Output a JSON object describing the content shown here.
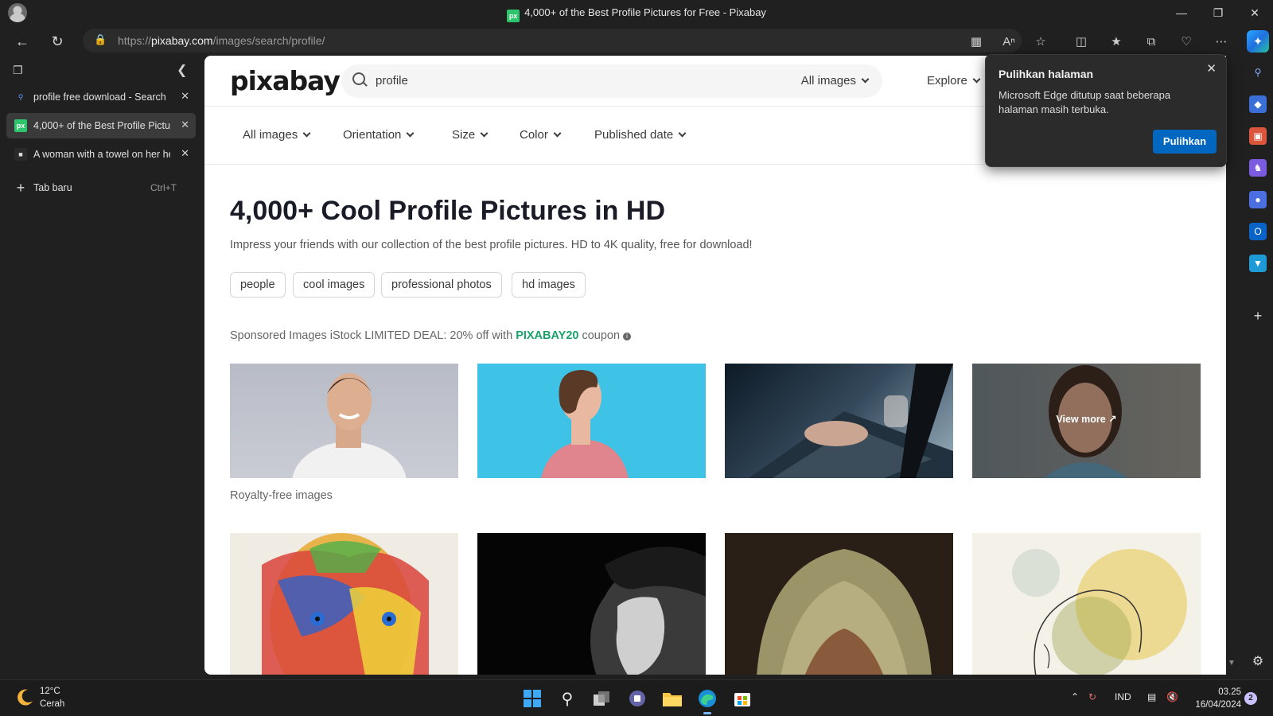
{
  "window": {
    "title": "4,000+ of the Best Profile Pictures for Free - Pixabay",
    "favicon_text": "px"
  },
  "address": {
    "url_prefix": "https://",
    "url_host": "pixabay.com",
    "url_path": "/images/search/profile/"
  },
  "tabs": [
    {
      "label": "profile free download - Search",
      "active": false
    },
    {
      "label": "4,000+ of the Best Profile Pictures for Free - Pixabay",
      "active": true
    },
    {
      "label": "A woman with a towel on her head",
      "active": false
    }
  ],
  "new_tab": {
    "label": "Tab baru",
    "shortcut": "Ctrl+T"
  },
  "site": {
    "logo": "pixabay",
    "search_value": "profile",
    "search_type": "All images",
    "explore": "Explore"
  },
  "filters": [
    "All images",
    "Orientation",
    "Size",
    "Color",
    "Published date"
  ],
  "content": {
    "heading": "4,000+ Cool Profile Pictures in HD",
    "subtitle": "Impress your friends with our collection of the best profile pictures. HD to 4K quality, free for download!",
    "chips": [
      "people",
      "cool images",
      "professional photos",
      "hd images"
    ],
    "sponsored_prefix": "Sponsored Images iStock LIMITED DEAL: 20% off with",
    "coupon_code": "PIXABAY20",
    "sponsored_suffix": "coupon",
    "view_more": "View more",
    "royalty_label": "Royalty-free images"
  },
  "popup": {
    "title": "Pulihkan halaman",
    "body": "Microsoft Edge ditutup saat beberapa halaman masih terbuka.",
    "button": "Pulihkan"
  },
  "taskbar": {
    "temperature": "12°C",
    "condition": "Cerah",
    "language": "IND",
    "time": "03.25",
    "date": "16/04/2024",
    "notification_count": "2"
  },
  "colors": {
    "brand_green": "#2ec66d",
    "coupon_green": "#1aa26a",
    "edge_blue": "#0067c0"
  }
}
